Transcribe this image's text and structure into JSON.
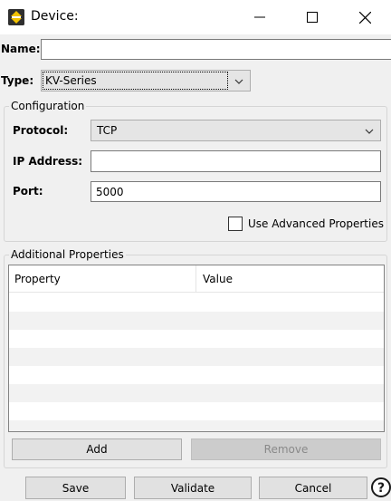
{
  "window": {
    "title": "Device:",
    "app_icon": "app-logo-icon",
    "controls": [
      "minimize-icon",
      "maximize-icon",
      "close-icon"
    ]
  },
  "form": {
    "name_label": "Name:",
    "name_value": "",
    "type_label": "Type:",
    "type_value": "KV-Series"
  },
  "configuration": {
    "legend": "Configuration",
    "protocol_label": "Protocol:",
    "protocol_value": "TCP",
    "ip_label": "IP Address:",
    "ip_value": "",
    "port_label": "Port:",
    "port_value": "5000",
    "advanced_label": "Use Advanced Properties",
    "advanced_checked": false
  },
  "additional": {
    "legend": "Additional Properties",
    "columns": [
      "Property",
      "Value"
    ],
    "rows": [],
    "add_label": "Add",
    "remove_label": "Remove"
  },
  "footer": {
    "save_label": "Save",
    "validate_label": "Validate",
    "cancel_label": "Cancel",
    "help_icon": "help-icon"
  }
}
